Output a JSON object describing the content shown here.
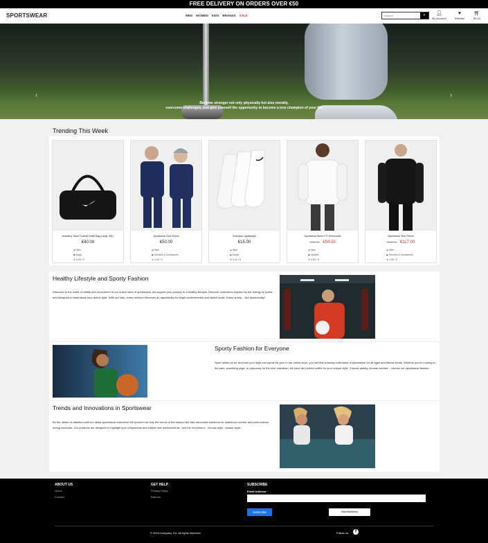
{
  "promo_bar": {
    "text": "FREE DELIVERY ON ORDERS OVER €50"
  },
  "header": {
    "logo": "SPORTSWEAR",
    "nav": [
      {
        "label": "MEN"
      },
      {
        "label": "WOMEN"
      },
      {
        "label": "KIDS"
      },
      {
        "label": "BRANDS"
      },
      {
        "label": "SALE"
      }
    ],
    "search_placeholder": "Search",
    "account_label": "My Account",
    "wishlist_label": "Wishlist",
    "cart_label": "€0.00"
  },
  "hero": {
    "caption_line1": "Become stronger not only physically but also morally,",
    "caption_line2": "overcome challenges, and give yourself the opportunity to become a true champion of your life",
    "active_slide": 1,
    "slide_count": 3
  },
  "trending": {
    "title": "Trending This Week",
    "products": [
      {
        "name": "Academy Team Football Duffel Bag (Large, 56L)",
        "old_price": "",
        "price": "€40.00",
        "brand": "Nike",
        "category": "Bags",
        "rating": "5.00 / 5"
      },
      {
        "name": "Sportswear Club Fleece",
        "old_price": "",
        "price": "€50.00",
        "brand": "Nike",
        "category": "Hoodies & Sweatshirts",
        "rating": "4.90 / 5"
      },
      {
        "name": "Everyday Lightweight",
        "old_price": "",
        "price": "€15.00",
        "brand": "Nike",
        "category": "Socks",
        "rating": "5.00 / 5"
      },
      {
        "name": "Sportswear Storm-FIT Windrunner",
        "old_price": "€200.00",
        "price": "€94.50",
        "brand": "Nike",
        "category": "Jackets",
        "rating": "4.80 / 5"
      },
      {
        "name": "Sportswear Tech Fleece",
        "old_price": "€180.00",
        "price": "€117.00",
        "brand": "Nike",
        "category": "Hoodies & Sweatshirts",
        "rating": "4.80 / 5"
      }
    ]
  },
  "sections": [
    {
      "title": "Healthy Lifestyle and Sporty Fashion",
      "text": "Welcome to the world of vitality and movement! In our online store of sportswear, we support your journey to a healthy lifestyle. Discover collections inspired by the energy of sports and designed to emphasize your active style. With our help, every workout becomes an opportunity for bright achievements and stylish looks. Dress sporty – live dynamically!"
    },
    {
      "title": "Sporty Fashion for Everyone",
      "text": "Sport unites us all, and now your style can speak for you! In our online store, you will find amazing collections of sportswear for all ages and fitness levels. Whether you're running in the park, practicing yoga, or preparing for the next marathon, we have the perfect outfits for your unique style. Choose quality, choose comfort – choose our sportswear fashion."
    },
    {
      "title": "Trends and Innovations in Sportswear",
      "text": "Be the center of attention with our latest sportswear collection! We present not only the trends of the season but also innovative solutions for maximum comfort and performance during workouts. Our products are designed to highlight your uniqueness and inspire new achievements. Join the movement – choose style, choose sport."
    }
  ],
  "footer": {
    "about": {
      "heading": "ABOUT US",
      "links": [
        "Home",
        "Contact"
      ]
    },
    "help": {
      "heading": "GET HELP",
      "links": [
        "Privacy Policy",
        "Returns"
      ]
    },
    "subscribe": {
      "heading": "SUBSCRIBE",
      "email_label": "Email Address",
      "required_mark": "*",
      "button": "Subscribe",
      "badge": "Intuit Mailchimp"
    },
    "copyright": "© 2024 Company, Inc. All rights reserved.",
    "follow": "Follow us:"
  },
  "colors": {
    "sale": "#e53935",
    "discount_price": "#c0392b",
    "subscribe_button": "#1a73e8"
  }
}
